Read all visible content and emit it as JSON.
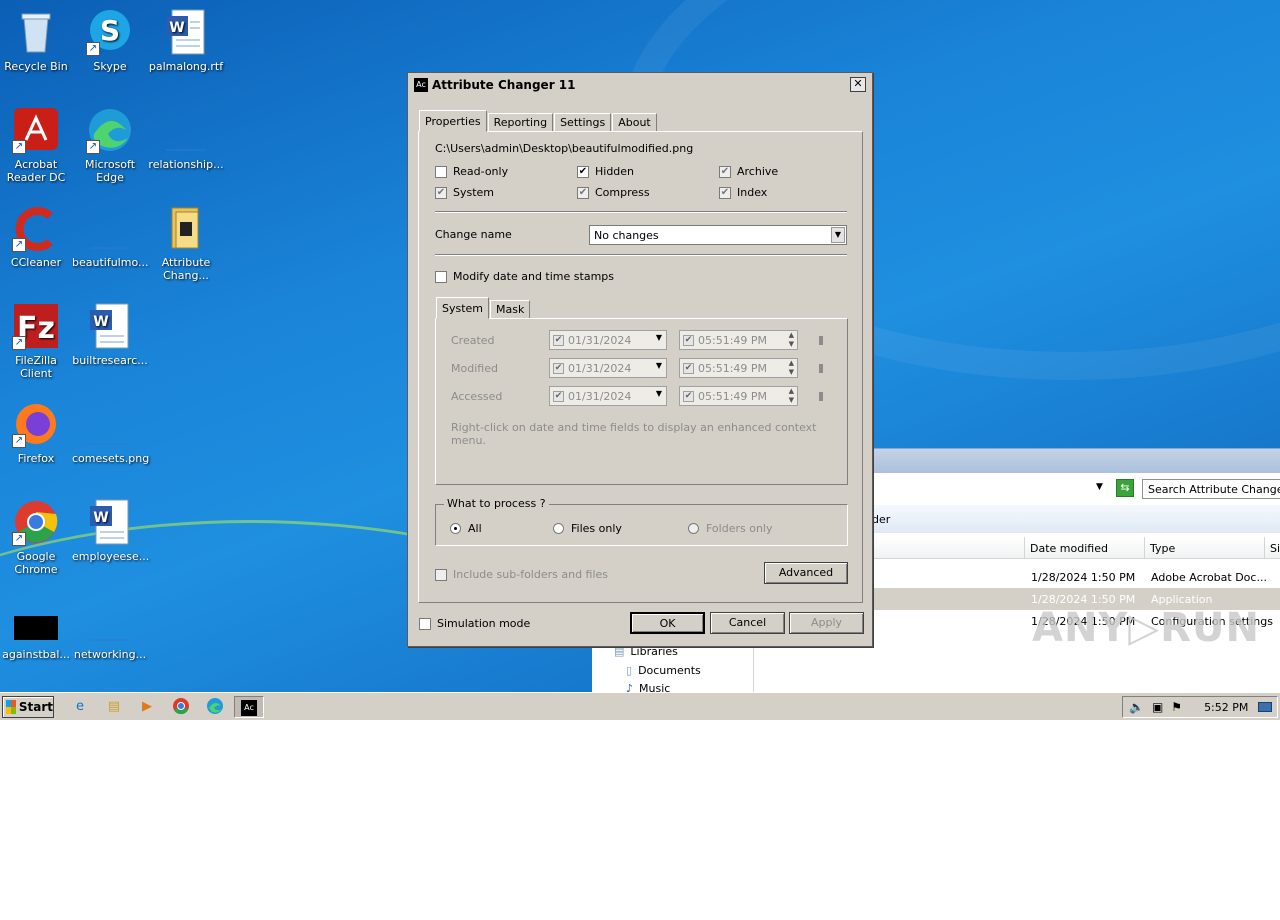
{
  "desktop": {
    "icons": [
      {
        "label": "Recycle Bin",
        "icon": "recycle-bin-icon"
      },
      {
        "label": "Skype",
        "icon": "skype-icon"
      },
      {
        "label": "palmalong.rtf",
        "icon": "word-document-icon"
      },
      {
        "label": "Acrobat Reader DC",
        "icon": "acrobat-icon"
      },
      {
        "label": "Microsoft Edge",
        "icon": "edge-icon"
      },
      {
        "label": "relationship...",
        "icon": "blank-file-icon"
      },
      {
        "label": "CCleaner",
        "icon": "ccleaner-icon"
      },
      {
        "label": "beautifulmo...",
        "icon": "blank-file-icon"
      },
      {
        "label": "Attribute Chang...",
        "icon": "folder-icon"
      },
      {
        "label": "FileZilla Client",
        "icon": "filezilla-icon"
      },
      {
        "label": "builtresearc...",
        "icon": "word-document-icon"
      },
      {
        "label": "Firefox",
        "icon": "firefox-icon"
      },
      {
        "label": "comesets.png",
        "icon": "blank-file-icon"
      },
      {
        "label": "Google Chrome",
        "icon": "chrome-icon"
      },
      {
        "label": "employeese...",
        "icon": "word-document-icon"
      },
      {
        "label": "againstbal...",
        "icon": "black-file-icon"
      },
      {
        "label": "networking...",
        "icon": "blank-file-icon"
      }
    ]
  },
  "explorer": {
    "search_placeholder": "Search Attribute Changer F",
    "toolbar_text": "der",
    "columns": [
      "Date modified",
      "Type",
      "Si"
    ],
    "rows": [
      {
        "date": "1/28/2024 1:50 PM",
        "type": "Adobe Acrobat Doc..."
      },
      {
        "date": "1/28/2024 1:50 PM",
        "type": "Application"
      },
      {
        "date": "1/28/2024 1:50 PM",
        "type": "Configuration settings"
      }
    ],
    "nav": [
      "Libraries",
      "Documents",
      "Music"
    ]
  },
  "dialog": {
    "title": "Attribute Changer 11",
    "tabs": [
      "Properties",
      "Reporting",
      "Settings",
      "About"
    ],
    "file_path": "C:\\Users\\admin\\Desktop\\beautifulmodified.png",
    "attributes": [
      {
        "label": "Read-only",
        "state": "unchecked"
      },
      {
        "label": "Hidden",
        "state": "checked"
      },
      {
        "label": "Archive",
        "state": "grey"
      },
      {
        "label": "System",
        "state": "grey"
      },
      {
        "label": "Compress",
        "state": "grey"
      },
      {
        "label": "Index",
        "state": "grey"
      }
    ],
    "change_name_label": "Change name",
    "change_name_value": "No changes",
    "modify_dates_label": "Modify date and time stamps",
    "subtabs": [
      "System",
      "Mask"
    ],
    "date_rows": [
      {
        "label": "Created",
        "date": "01/31/2024",
        "time": "05:51:49  PM"
      },
      {
        "label": "Modified",
        "date": "01/31/2024",
        "time": "05:51:49  PM"
      },
      {
        "label": "Accessed",
        "date": "01/31/2024",
        "time": "05:51:49  PM"
      }
    ],
    "hint": "Right-click on date and time fields to display an enhanced context menu.",
    "process_group": "What to process ?",
    "process_options": [
      "All",
      "Files only",
      "Folders only"
    ],
    "subfolders_label": "Include sub-folders and files",
    "advanced_label": "Advanced",
    "simulation_label": "Simulation mode",
    "ok_label": "OK",
    "cancel_label": "Cancel",
    "apply_label": "Apply"
  },
  "taskbar": {
    "start_label": "Start",
    "clock": "5:52 PM"
  }
}
